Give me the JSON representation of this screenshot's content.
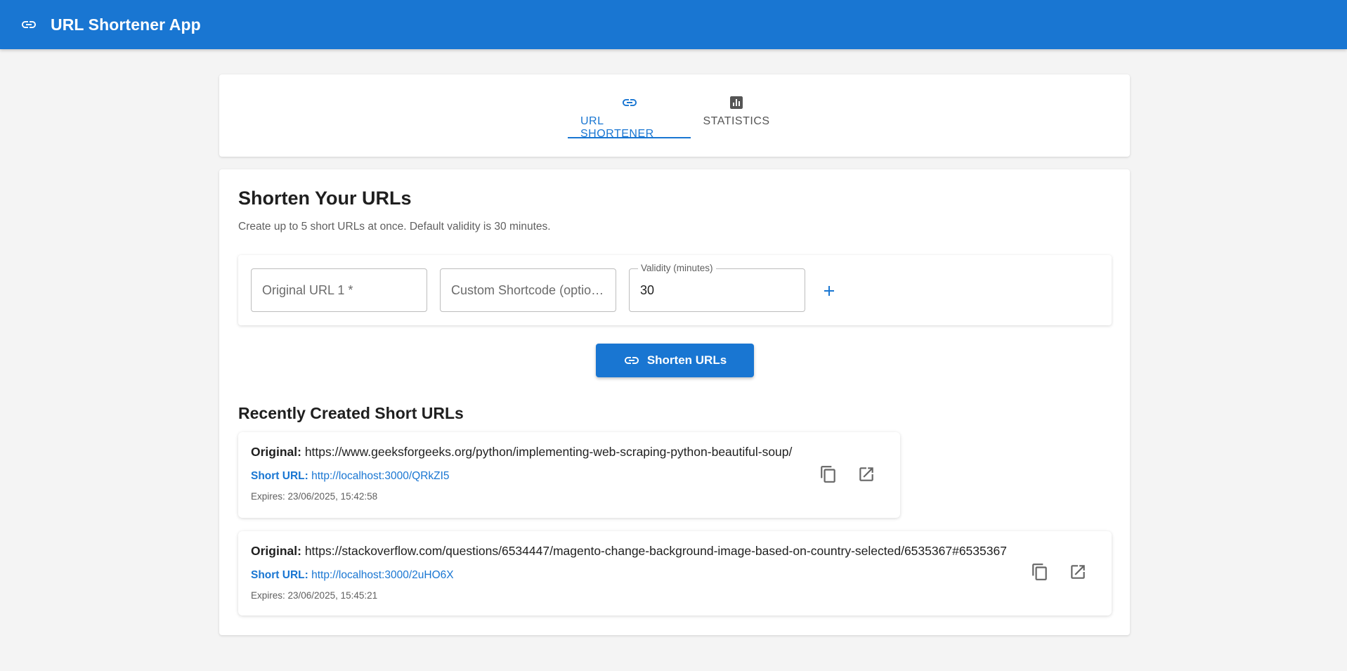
{
  "app": {
    "title": "URL Shortener App",
    "brand_color": "#1976d2"
  },
  "tabs": [
    {
      "label": "URL SHORTENER",
      "icon": "link-icon",
      "active": true
    },
    {
      "label": "STATISTICS",
      "icon": "bar-chart-icon",
      "active": false
    }
  ],
  "main": {
    "title": "Shorten Your URLs",
    "subtitle": "Create up to 5 short URLs at once. Default validity is 30 minutes.",
    "form": {
      "original_url_placeholder": "Original URL 1 *",
      "original_url_value": "",
      "shortcode_placeholder": "Custom Shortcode (optional)",
      "shortcode_value": "",
      "validity_label": "Validity (minutes)",
      "validity_value": "30",
      "add_icon": "plus-icon"
    },
    "shorten_button_label": "Shorten URLs"
  },
  "recent": {
    "title": "Recently Created Short URLs",
    "original_label": "Original:",
    "short_label": "Short URL:",
    "items": [
      {
        "original": "https://www.geeksforgeeks.org/python/implementing-web-scraping-python-beautiful-soup/",
        "short_url": "http://localhost:3000/QRkZI5",
        "expires": "Expires: 23/06/2025, 15:42:58"
      },
      {
        "original": "https://stackoverflow.com/questions/6534447/magento-change-background-image-based-on-country-selected/6535367#6535367",
        "short_url": "http://localhost:3000/2uHO6X",
        "expires": "Expires: 23/06/2025, 15:45:21"
      }
    ]
  }
}
